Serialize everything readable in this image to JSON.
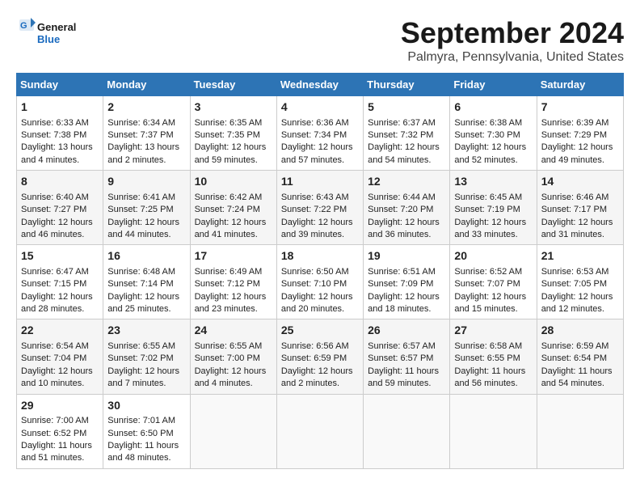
{
  "header": {
    "logo_line1": "General",
    "logo_line2": "Blue",
    "title": "September 2024",
    "subtitle": "Palmyra, Pennsylvania, United States"
  },
  "columns": [
    "Sunday",
    "Monday",
    "Tuesday",
    "Wednesday",
    "Thursday",
    "Friday",
    "Saturday"
  ],
  "weeks": [
    [
      {
        "day": "1",
        "lines": [
          "Sunrise: 6:33 AM",
          "Sunset: 7:38 PM",
          "Daylight: 13 hours",
          "and 4 minutes."
        ]
      },
      {
        "day": "2",
        "lines": [
          "Sunrise: 6:34 AM",
          "Sunset: 7:37 PM",
          "Daylight: 13 hours",
          "and 2 minutes."
        ]
      },
      {
        "day": "3",
        "lines": [
          "Sunrise: 6:35 AM",
          "Sunset: 7:35 PM",
          "Daylight: 12 hours",
          "and 59 minutes."
        ]
      },
      {
        "day": "4",
        "lines": [
          "Sunrise: 6:36 AM",
          "Sunset: 7:34 PM",
          "Daylight: 12 hours",
          "and 57 minutes."
        ]
      },
      {
        "day": "5",
        "lines": [
          "Sunrise: 6:37 AM",
          "Sunset: 7:32 PM",
          "Daylight: 12 hours",
          "and 54 minutes."
        ]
      },
      {
        "day": "6",
        "lines": [
          "Sunrise: 6:38 AM",
          "Sunset: 7:30 PM",
          "Daylight: 12 hours",
          "and 52 minutes."
        ]
      },
      {
        "day": "7",
        "lines": [
          "Sunrise: 6:39 AM",
          "Sunset: 7:29 PM",
          "Daylight: 12 hours",
          "and 49 minutes."
        ]
      }
    ],
    [
      {
        "day": "8",
        "lines": [
          "Sunrise: 6:40 AM",
          "Sunset: 7:27 PM",
          "Daylight: 12 hours",
          "and 46 minutes."
        ]
      },
      {
        "day": "9",
        "lines": [
          "Sunrise: 6:41 AM",
          "Sunset: 7:25 PM",
          "Daylight: 12 hours",
          "and 44 minutes."
        ]
      },
      {
        "day": "10",
        "lines": [
          "Sunrise: 6:42 AM",
          "Sunset: 7:24 PM",
          "Daylight: 12 hours",
          "and 41 minutes."
        ]
      },
      {
        "day": "11",
        "lines": [
          "Sunrise: 6:43 AM",
          "Sunset: 7:22 PM",
          "Daylight: 12 hours",
          "and 39 minutes."
        ]
      },
      {
        "day": "12",
        "lines": [
          "Sunrise: 6:44 AM",
          "Sunset: 7:20 PM",
          "Daylight: 12 hours",
          "and 36 minutes."
        ]
      },
      {
        "day": "13",
        "lines": [
          "Sunrise: 6:45 AM",
          "Sunset: 7:19 PM",
          "Daylight: 12 hours",
          "and 33 minutes."
        ]
      },
      {
        "day": "14",
        "lines": [
          "Sunrise: 6:46 AM",
          "Sunset: 7:17 PM",
          "Daylight: 12 hours",
          "and 31 minutes."
        ]
      }
    ],
    [
      {
        "day": "15",
        "lines": [
          "Sunrise: 6:47 AM",
          "Sunset: 7:15 PM",
          "Daylight: 12 hours",
          "and 28 minutes."
        ]
      },
      {
        "day": "16",
        "lines": [
          "Sunrise: 6:48 AM",
          "Sunset: 7:14 PM",
          "Daylight: 12 hours",
          "and 25 minutes."
        ]
      },
      {
        "day": "17",
        "lines": [
          "Sunrise: 6:49 AM",
          "Sunset: 7:12 PM",
          "Daylight: 12 hours",
          "and 23 minutes."
        ]
      },
      {
        "day": "18",
        "lines": [
          "Sunrise: 6:50 AM",
          "Sunset: 7:10 PM",
          "Daylight: 12 hours",
          "and 20 minutes."
        ]
      },
      {
        "day": "19",
        "lines": [
          "Sunrise: 6:51 AM",
          "Sunset: 7:09 PM",
          "Daylight: 12 hours",
          "and 18 minutes."
        ]
      },
      {
        "day": "20",
        "lines": [
          "Sunrise: 6:52 AM",
          "Sunset: 7:07 PM",
          "Daylight: 12 hours",
          "and 15 minutes."
        ]
      },
      {
        "day": "21",
        "lines": [
          "Sunrise: 6:53 AM",
          "Sunset: 7:05 PM",
          "Daylight: 12 hours",
          "and 12 minutes."
        ]
      }
    ],
    [
      {
        "day": "22",
        "lines": [
          "Sunrise: 6:54 AM",
          "Sunset: 7:04 PM",
          "Daylight: 12 hours",
          "and 10 minutes."
        ]
      },
      {
        "day": "23",
        "lines": [
          "Sunrise: 6:55 AM",
          "Sunset: 7:02 PM",
          "Daylight: 12 hours",
          "and 7 minutes."
        ]
      },
      {
        "day": "24",
        "lines": [
          "Sunrise: 6:55 AM",
          "Sunset: 7:00 PM",
          "Daylight: 12 hours",
          "and 4 minutes."
        ]
      },
      {
        "day": "25",
        "lines": [
          "Sunrise: 6:56 AM",
          "Sunset: 6:59 PM",
          "Daylight: 12 hours",
          "and 2 minutes."
        ]
      },
      {
        "day": "26",
        "lines": [
          "Sunrise: 6:57 AM",
          "Sunset: 6:57 PM",
          "Daylight: 11 hours",
          "and 59 minutes."
        ]
      },
      {
        "day": "27",
        "lines": [
          "Sunrise: 6:58 AM",
          "Sunset: 6:55 PM",
          "Daylight: 11 hours",
          "and 56 minutes."
        ]
      },
      {
        "day": "28",
        "lines": [
          "Sunrise: 6:59 AM",
          "Sunset: 6:54 PM",
          "Daylight: 11 hours",
          "and 54 minutes."
        ]
      }
    ],
    [
      {
        "day": "29",
        "lines": [
          "Sunrise: 7:00 AM",
          "Sunset: 6:52 PM",
          "Daylight: 11 hours",
          "and 51 minutes."
        ]
      },
      {
        "day": "30",
        "lines": [
          "Sunrise: 7:01 AM",
          "Sunset: 6:50 PM",
          "Daylight: 11 hours",
          "and 48 minutes."
        ]
      },
      {
        "day": "",
        "lines": []
      },
      {
        "day": "",
        "lines": []
      },
      {
        "day": "",
        "lines": []
      },
      {
        "day": "",
        "lines": []
      },
      {
        "day": "",
        "lines": []
      }
    ]
  ]
}
